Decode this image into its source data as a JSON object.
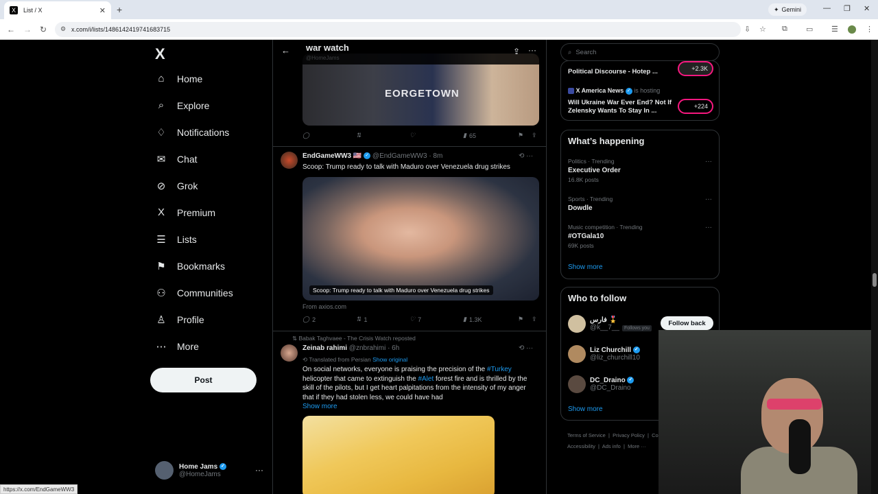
{
  "browser": {
    "tab_title": "List / X",
    "tab_favicon": "X",
    "new_tab": "+",
    "url": "x.com/i/lists/1486142419741683715",
    "gemini": "Gemini",
    "status_url": "https://x.com/EndGameWW3"
  },
  "nav": {
    "logo": "X",
    "items": [
      {
        "label": "Home",
        "icon": "⌂"
      },
      {
        "label": "Explore",
        "icon": "⌕"
      },
      {
        "label": "Notifications",
        "icon": "♢"
      },
      {
        "label": "Chat",
        "icon": "✉"
      },
      {
        "label": "Grok",
        "icon": "⊘"
      },
      {
        "label": "Premium",
        "icon": "X"
      },
      {
        "label": "Lists",
        "icon": "☰"
      },
      {
        "label": "Bookmarks",
        "icon": "⚑"
      },
      {
        "label": "Communities",
        "icon": "⚇"
      },
      {
        "label": "Profile",
        "icon": "♙"
      },
      {
        "label": "More",
        "icon": "⋯"
      }
    ],
    "post_label": "Post",
    "account": {
      "name": "Home Jams",
      "handle": "@HomeJams",
      "more": "···"
    }
  },
  "header": {
    "title": "war watch",
    "subtitle": "@HomeJams"
  },
  "tweet0": {
    "media_text": "EORGETOWN",
    "replies": "",
    "reposts": "",
    "likes": "",
    "views": "65"
  },
  "tweet1": {
    "name": "EndGameWW3 🇺🇸",
    "handle": "@EndGameWW3 · 8m",
    "text": "Scoop: Trump ready to talk with Maduro over Venezuela drug strikes",
    "media_caption": "Scoop: Trump ready to talk with Maduro over Venezuela drug strikes",
    "source": "From axios.com",
    "replies": "2",
    "reposts": "1",
    "likes": "7",
    "views": "1.3K"
  },
  "tweet2": {
    "repost_by": "Babak Taghvaee - The Crisis Watch reposted",
    "name": "Zeinab rahimi",
    "handle": "@znbrahimi · 6h",
    "translated": "Translated from Persian",
    "show_original": "Show original",
    "text_a": "On social networks, everyone is praising the precision of the ",
    "tag_turkey": "#Turkey",
    "text_b": "helicopter that came to extinguish the ",
    "tag_alet": "#Alet",
    "text_c": " forest fire and is thrilled by the skill of the pilots, but I get heart palpitations from the intensity of my anger that if they had stolen less, we could have had",
    "show_more": "Show more"
  },
  "sidebar": {
    "search_placeholder": "Search",
    "spaces": [
      {
        "title": "Political Discourse - Hotep ...",
        "count": "+2.3K"
      },
      {
        "host": "X America News",
        "host_suffix": "is hosting",
        "title": "Will Ukraine War Ever End? Not If Zelensky Wants To Stay In ...",
        "count": "+224"
      }
    ],
    "happening_title": "What’s happening",
    "trends": [
      {
        "cat": "Politics · Trending",
        "name": "Executive Order",
        "count": "16.8K posts"
      },
      {
        "cat": "Sports · Trending",
        "name": "Dowdle",
        "count": ""
      },
      {
        "cat": "Music competition · Trending",
        "name": "#OTGala10",
        "count": "69K posts"
      }
    ],
    "show_more": "Show more",
    "who_title": "Who to follow",
    "follow": [
      {
        "name": "فارس 🎖️",
        "handle": "@k__7__",
        "follows_you": "Follows you",
        "button": "Follow back"
      },
      {
        "name": "Liz Churchill",
        "handle": "@liz_churchill10"
      },
      {
        "name": "DC_Draino",
        "handle": "@DC_Draino"
      }
    ],
    "who_show_more": "Show more",
    "footer_line1": [
      "Terms of Service",
      "Privacy Policy",
      "Cookie Policy"
    ],
    "footer_line2": [
      "Accessibility",
      "Ads info",
      "More ···"
    ]
  }
}
